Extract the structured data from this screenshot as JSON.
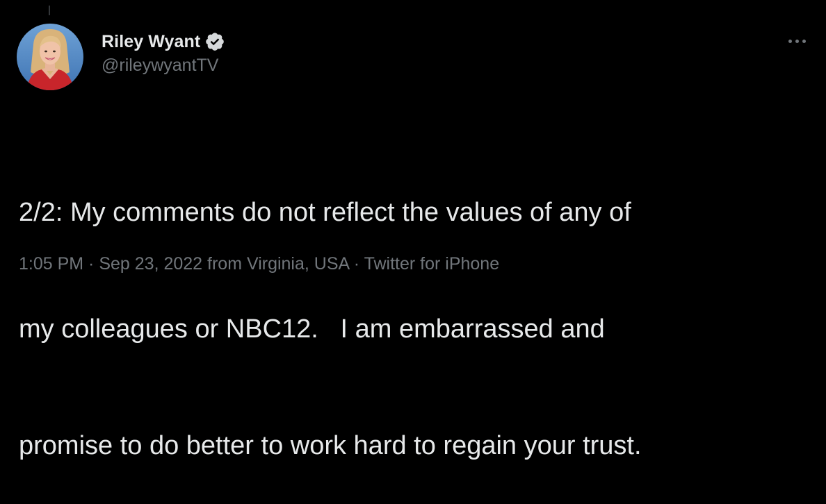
{
  "tweet": {
    "author": {
      "display_name": "Riley Wyant",
      "handle": "@rileywyantTV",
      "verified": true,
      "verified_icon": "verified-badge-icon"
    },
    "text_lines": [
      "2/2: My comments do not reflect the values of any of",
      "my colleagues or NBC12.   I am embarrassed and",
      "promise to do better to work hard to regain your trust."
    ],
    "meta": {
      "time": "1:05 PM",
      "separator": " · ",
      "date": "Sep 23, 2022",
      "location": " from Virginia, USA",
      "separator2": " · ",
      "source": "Twitter for iPhone"
    },
    "more_icon": "more-options-icon"
  },
  "colors": {
    "background": "#000000",
    "text_primary": "#e7e9ea",
    "text_secondary": "#71767b",
    "verified_badge": "#d6d9db"
  }
}
